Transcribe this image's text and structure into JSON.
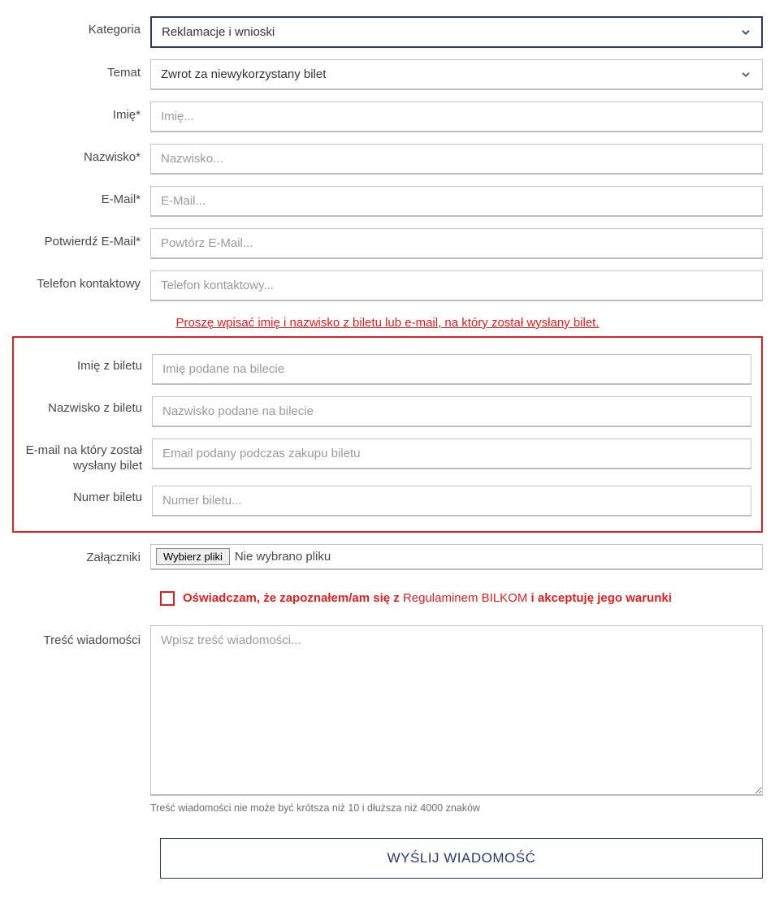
{
  "labels": {
    "category": "Kategoria",
    "topic": "Temat",
    "firstName": "Imię*",
    "lastName": "Nazwisko*",
    "email": "E-Mail*",
    "emailConfirm": "Potwierdź E-Mail*",
    "phone": "Telefon kontaktowy",
    "ticketFirstName": "Imię z biletu",
    "ticketLastName": "Nazwisko z biletu",
    "ticketEmail": "E-mail na który został wysłany bilet",
    "ticketNumber": "Numer biletu",
    "attachments": "Załączniki",
    "message": "Treść wiadomości"
  },
  "selects": {
    "categoryValue": "Reklamacje i wnioski",
    "topicValue": "Zwrot za niewykorzystany bilet"
  },
  "placeholders": {
    "firstName": "Imię...",
    "lastName": "Nazwisko...",
    "email": "E-Mail...",
    "emailConfirm": "Powtórz E-Mail...",
    "phone": "Telefon kontaktowy...",
    "ticketFirstName": "Imię podane na bilecie",
    "ticketLastName": "Nazwisko podane na bilecie",
    "ticketEmail": "Email podany podczas zakupu biletu",
    "ticketNumber": "Numer biletu...",
    "message": "Wpisz treść wiadomości..."
  },
  "infoLine": "Proszę wpisać imię i nazwisko z biletu lub e-mail, na który został wysłany bilet.",
  "file": {
    "button": "Wybierz pliki",
    "status": "Nie wybrano pliku"
  },
  "consent": {
    "prefix": "Oświadczam, że zapoznałem/am się z ",
    "link": "Regulaminem BILKOM",
    "suffix": " i akceptuję jego warunki"
  },
  "note": "Treść wiadomości nie może być krótsza niż 10 i dłuższa niż 4000 znaków",
  "submit": "WYŚLIJ WIADOMOŚĆ"
}
